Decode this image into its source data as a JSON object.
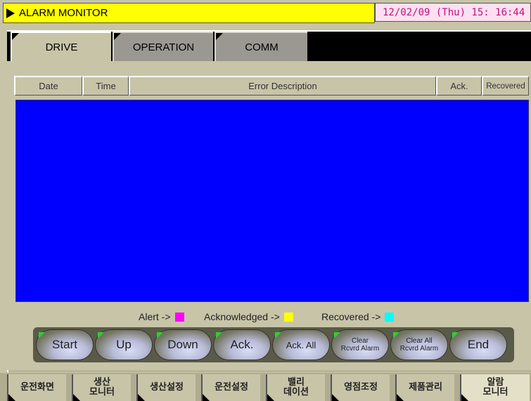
{
  "window": {
    "title": "ALARM MONITOR",
    "datetime": "12/02/09 (Thu) 15: 16:44"
  },
  "tabs": [
    {
      "label": "DRIVE",
      "active": true
    },
    {
      "label": "OPERATION",
      "active": false
    },
    {
      "label": "COMM",
      "active": false
    }
  ],
  "table": {
    "columns": [
      "Date",
      "Time",
      "Error Description",
      "Ack.",
      "Recovered"
    ],
    "rows": []
  },
  "legend": {
    "alert_label": "Alert ->",
    "alert_color": "#ff00ff",
    "acknowledged_label": "Acknowledged ->",
    "acknowledged_color": "#ffff00",
    "recovered_label": "Recovered ->",
    "recovered_color": "#00ffff"
  },
  "buttons": {
    "start": "Start",
    "up": "Up",
    "down": "Down",
    "ack": "Ack.",
    "ack_all": "Ack. All",
    "clear_rcvrd_line1": "Clear",
    "clear_rcvrd_line2": "Rcvrd Alarm",
    "clear_all_line1": "Clear All",
    "clear_all_line2": "Rcvrd Alarm",
    "end": "End"
  },
  "nav": [
    {
      "label": "운전화면",
      "active": false
    },
    {
      "label": "생산\n모니터",
      "active": false
    },
    {
      "label": "생산설정",
      "active": false
    },
    {
      "label": "운전설정",
      "active": false
    },
    {
      "label": "밸리\n데이션",
      "active": false
    },
    {
      "label": "영점조정",
      "active": false
    },
    {
      "label": "제품관리",
      "active": false
    },
    {
      "label": "알람\n모니터",
      "active": true
    }
  ],
  "colors": {
    "alarm_area_bg": "#0000ff",
    "title_bg": "#ffff00",
    "datetime_color": "#c01080"
  }
}
